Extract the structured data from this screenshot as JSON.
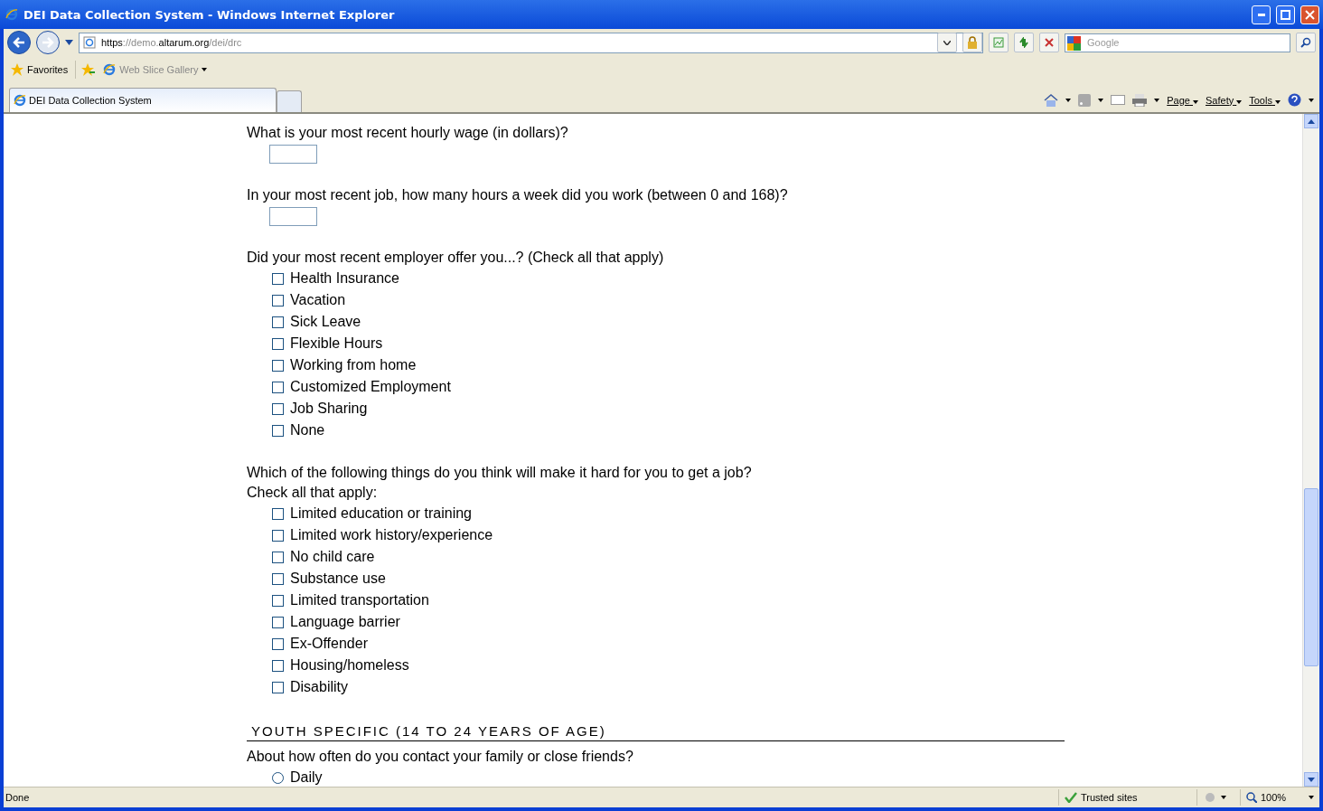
{
  "window": {
    "title": "DEI Data Collection System - Windows Internet Explorer"
  },
  "address": {
    "parts": [
      {
        "text": "https",
        "dim": false
      },
      {
        "text": "://demo.",
        "dim": true
      },
      {
        "text": "altarum.org",
        "dim": false
      },
      {
        "text": "/dei/drc",
        "dim": true
      }
    ]
  },
  "search": {
    "placeholder": "Google"
  },
  "favorites_bar": {
    "favorites": "Favorites",
    "items": [
      "Web Slice Gallery"
    ]
  },
  "tabs": [
    {
      "label": "DEI Data Collection System",
      "selected": true
    }
  ],
  "command_bar": {
    "menus": [
      "Page",
      "Safety",
      "Tools"
    ]
  },
  "form": [
    {
      "kind": "text_input",
      "question": "What is your most recent hourly wage (in dollars)?"
    },
    {
      "kind": "text_input",
      "question": "In your most recent job, how many hours a week did you work (between 0 and 168)?"
    },
    {
      "kind": "checkbox_list",
      "question": "Did your most recent employer offer you...? (Check all that apply)",
      "options": [
        {
          "label": "Health Insurance",
          "checked": false
        },
        {
          "label": "Vacation",
          "checked": false
        },
        {
          "label": "Sick Leave",
          "checked": false
        },
        {
          "label": "Flexible Hours",
          "checked": false
        },
        {
          "label": "Working from home",
          "checked": false
        },
        {
          "label": "Customized Employment",
          "checked": false
        },
        {
          "label": "Job Sharing",
          "checked": false
        },
        {
          "label": "None",
          "checked": false
        }
      ]
    },
    {
      "kind": "checkbox_list",
      "question": "Which of the following things do you think will make it hard for you to get a job?",
      "note": "Check all that apply:",
      "options": [
        {
          "label": "Limited education or training",
          "checked": false
        },
        {
          "label": "Limited work history/experience",
          "checked": false
        },
        {
          "label": "No child care",
          "checked": false
        },
        {
          "label": "Substance use",
          "checked": false
        },
        {
          "label": "Limited transportation",
          "checked": false
        },
        {
          "label": "Language barrier",
          "checked": false
        },
        {
          "label": "Ex-Offender",
          "checked": false
        },
        {
          "label": "Housing/homeless",
          "checked": false
        },
        {
          "label": "Disability",
          "checked": false
        }
      ]
    },
    {
      "kind": "section",
      "title": "YOUTH SPECIFIC (14 TO 24 YEARS OF AGE)"
    },
    {
      "kind": "radio_list",
      "question": "About how often do you contact your family or close friends?",
      "options": [
        {
          "label": "Daily",
          "selected": false
        }
      ]
    }
  ],
  "status_bar": {
    "text": "Done",
    "zone": "Trusted sites",
    "zoom": "100%"
  }
}
